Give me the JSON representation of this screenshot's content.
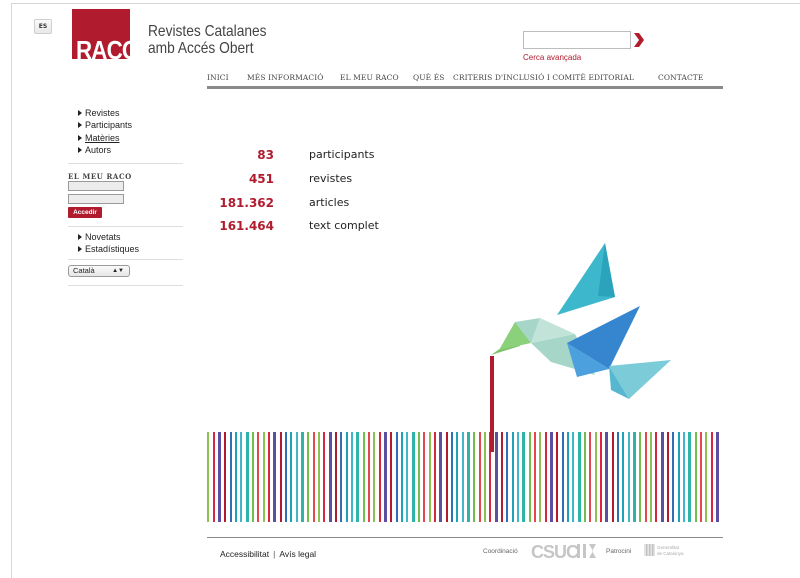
{
  "lang_button": "ES",
  "logo": {
    "text": "RACO"
  },
  "brand": {
    "line1": "Revistes Catalanes",
    "line2": "amb Accés Obert"
  },
  "search": {
    "placeholder": "",
    "advanced": "Cerca avançada",
    "go_icon": "chevron-right-icon"
  },
  "nav": [
    "INICI",
    "MÉS INFORMACIÓ",
    "EL MEU RACO",
    "QUÈ ÉS",
    "CRITERIS D'INCLUSIÓ I COMITÈ EDITORIAL",
    "CONTACTE"
  ],
  "sidebar": {
    "browse": [
      "Revistes",
      "Participants",
      "Matèries",
      "Autors"
    ],
    "meu_raco_title": "EL MEU RACO",
    "login_button": "Accedir",
    "extra": [
      "Novetats",
      "Estadístiques"
    ],
    "language": "Català"
  },
  "stats": [
    {
      "value": "83",
      "label": "participants"
    },
    {
      "value": "451",
      "label": "revistes"
    },
    {
      "value": "181.362",
      "label": "articles"
    },
    {
      "value": "161.464",
      "label": "text complet"
    }
  ],
  "footer": {
    "accessibility": "Accessibilitat",
    "separator": "|",
    "legal": "Avís legal",
    "coordination": "Coordinació",
    "csuc": "CSUC",
    "patronage": "Patrocini",
    "generalitat_line1": "Generalitat",
    "generalitat_line2": "de Catalunya"
  },
  "colors": {
    "brand_red": "#b01c2e",
    "nav_rule": "#8a8a8a"
  }
}
